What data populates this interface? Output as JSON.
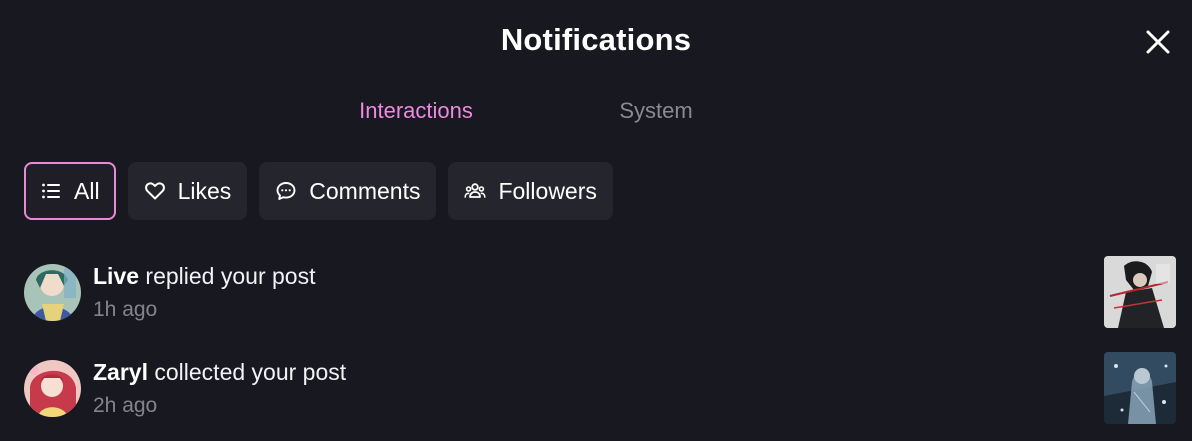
{
  "header": {
    "title": "Notifications",
    "close_icon": "close-icon"
  },
  "tabs": [
    {
      "label": "Interactions",
      "active": true
    },
    {
      "label": "System",
      "active": false
    }
  ],
  "filters": [
    {
      "label": "All",
      "icon": "list-icon",
      "active": true
    },
    {
      "label": "Likes",
      "icon": "heart-icon",
      "active": false
    },
    {
      "label": "Comments",
      "icon": "comment-icon",
      "active": false
    },
    {
      "label": "Followers",
      "icon": "users-icon",
      "active": false
    }
  ],
  "notifications": [
    {
      "user": "Live",
      "action": " replied your post",
      "time": "1h ago"
    },
    {
      "user": "Zaryl",
      "action": " collected your post",
      "time": "2h ago"
    }
  ],
  "colors": {
    "background": "#181820",
    "accent": "#ee89df",
    "chip": "#25252e",
    "muted": "#84848d"
  }
}
